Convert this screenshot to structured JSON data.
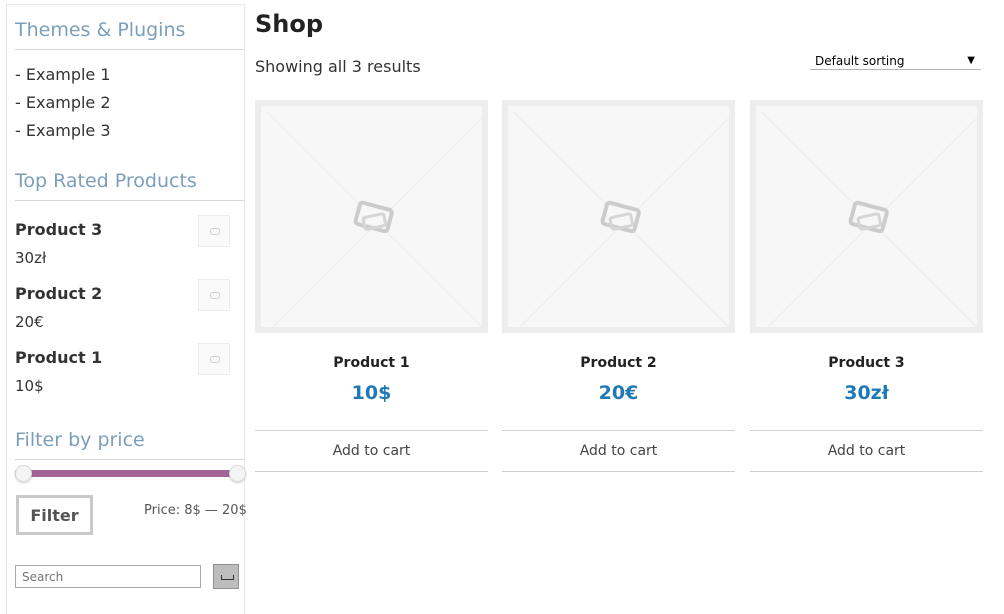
{
  "sidebar": {
    "themes_title": "Themes & Plugins",
    "theme_links": [
      "- Example 1",
      "- Example 2",
      "- Example 3"
    ],
    "top_rated_title": "Top Rated Products",
    "top_rated": [
      {
        "name": "Product 3",
        "price": "30zł"
      },
      {
        "name": "Product 2",
        "price": "20€"
      },
      {
        "name": "Product 1",
        "price": "10$"
      }
    ],
    "filter_title": "Filter by price",
    "filter_button": "Filter",
    "price_label": "Price: 8$ — 20$",
    "search_placeholder": "Search",
    "price_slider": {
      "min": 0.0,
      "max": 1.0
    }
  },
  "main": {
    "title": "Shop",
    "results": "Showing all 3 results",
    "sorting": {
      "selected": "Default sorting",
      "caret": "▼"
    },
    "products": [
      {
        "name": "Product 1",
        "price": "10$",
        "button": "Add to cart"
      },
      {
        "name": "Product 2",
        "price": "20€",
        "button": "Add to cart"
      },
      {
        "name": "Product 3",
        "price": "30zł",
        "button": "Add to cart"
      }
    ]
  },
  "colors": {
    "accent": "#a46497",
    "widget_title": "#7b9fba",
    "price": "#2079b6"
  },
  "icons": {
    "product_placeholder": "image-placeholder-icon",
    "thumb": "thumbnail-placeholder-icon",
    "search_submit": "search-submit-icon"
  }
}
